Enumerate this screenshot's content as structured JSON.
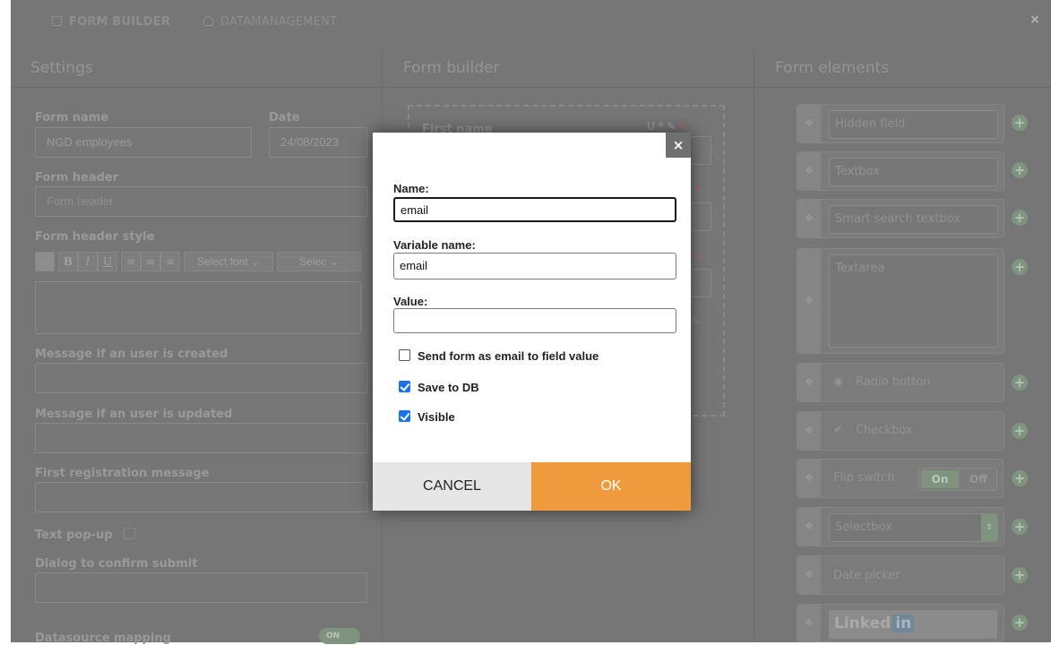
{
  "topbar": {
    "tabs": [
      {
        "label": "FORM BUILDER",
        "icon": "form-icon"
      },
      {
        "label": "DATAMANAGEMENT",
        "icon": "database-icon"
      }
    ],
    "close_icon": "×"
  },
  "columns": {
    "settings": "Settings",
    "builder": "Form builder",
    "elements": "Form elements"
  },
  "settings": {
    "form_name_label": "Form name",
    "form_name_value": "NGD employees",
    "date_label": "Date",
    "date_value": "24/08/2023",
    "form_header_label": "Form header",
    "form_header_placeholder": "Form header",
    "form_header_style_label": "Form header style",
    "toolbar": {
      "bold": "B",
      "italic": "I",
      "underline": "U",
      "font_select": "Select font",
      "size_select": "Selec"
    },
    "msg_created_label": "Message if an user is created",
    "msg_updated_label": "Message if an user is updated",
    "first_reg_label": "First registration message",
    "text_popup_label": "Text pop-up",
    "dialog_confirm_label": "Dialog to confirm submit",
    "datasource_label": "Datasource mapping",
    "datasource_toggle": "ON"
  },
  "builder": {
    "first_field_label": "First name",
    "action_icons": "U * ✎"
  },
  "elements": {
    "hidden": "Hidden field",
    "textbox": "Textbox",
    "smart": "Smart search textbox",
    "textarea": "Textarea",
    "radio": "Radio button",
    "checkbox": "Checkbox",
    "flip": "Flip switch",
    "flip_on": "On",
    "flip_off": "Off",
    "selectbox": "Selectbox",
    "datepicker": "Date picker",
    "linkedin": "Linked",
    "linkedin_in": "in"
  },
  "modal": {
    "name_label": "Name:",
    "name_value": "email",
    "var_label": "Variable name:",
    "var_value": "email",
    "value_label": "Value:",
    "value_value": "",
    "send_email_label": "Send form as email to field value",
    "send_email_checked": false,
    "save_db_label": "Save to DB",
    "save_db_checked": true,
    "visible_label": "Visible",
    "visible_checked": true,
    "cancel_label": "CANCEL",
    "ok_label": "OK",
    "close_icon": "×"
  },
  "colors": {
    "ok_button": "#f09a3e",
    "checkbox": "#1a73e8",
    "overlay": "#767676"
  }
}
